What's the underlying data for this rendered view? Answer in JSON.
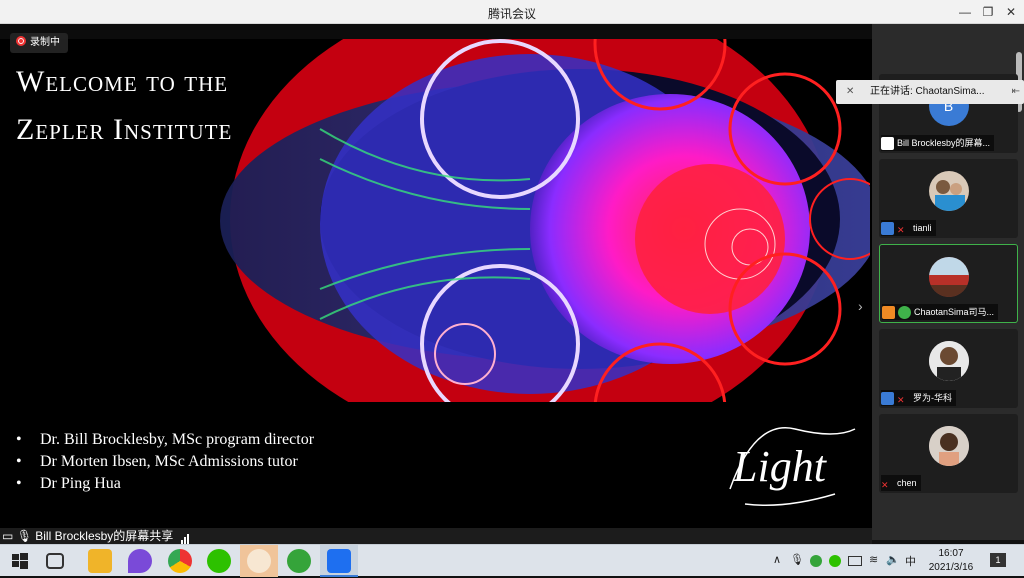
{
  "window": {
    "title": "腾讯会议"
  },
  "recording": {
    "label": "录制中"
  },
  "slide": {
    "title_line1": "Welcome to the",
    "title_line2": "Zepler Institute",
    "bullets": [
      "Dr. Bill Brocklesby, MSc program director",
      "Dr Morten Ibsen, MSc Admissions tutor",
      "Dr Ping Hua"
    ],
    "logo_text": "Light"
  },
  "share_bar": {
    "label": "Bill Brocklesby的屏幕共享"
  },
  "speaking": {
    "label": "正在讲话: ChaotanSima..."
  },
  "participants": [
    {
      "name": "Bill Brocklesby的屏幕...",
      "avatar_letter": "B"
    },
    {
      "name": "tianli"
    },
    {
      "name": "ChaotanSima司马..."
    },
    {
      "name": "罗为-华科"
    },
    {
      "name": "chen"
    }
  ],
  "clock": {
    "time": "16:07",
    "date": "2021/3/16"
  },
  "tray": {
    "ime": "中",
    "notifications": "1"
  },
  "colors": {
    "accent": "#3fb24a",
    "record": "#e33333"
  }
}
